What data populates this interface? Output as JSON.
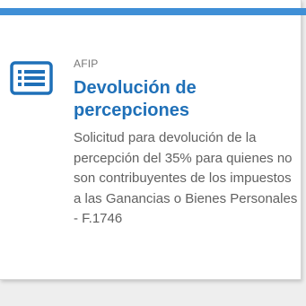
{
  "card": {
    "organization": "AFIP",
    "title": "Devolución de percepciones",
    "description": "Solicitud para devolución de la percepción del 35% para quienes no son contribuyentes de los impuestos a las Ganancias o Bienes Personales - F.1746",
    "icon": "list-document-icon"
  },
  "colors": {
    "accent": "#3f8fd6",
    "title": "#1f70b8",
    "icon": "#1f70b8",
    "text": "#616161",
    "muted": "#777777"
  }
}
